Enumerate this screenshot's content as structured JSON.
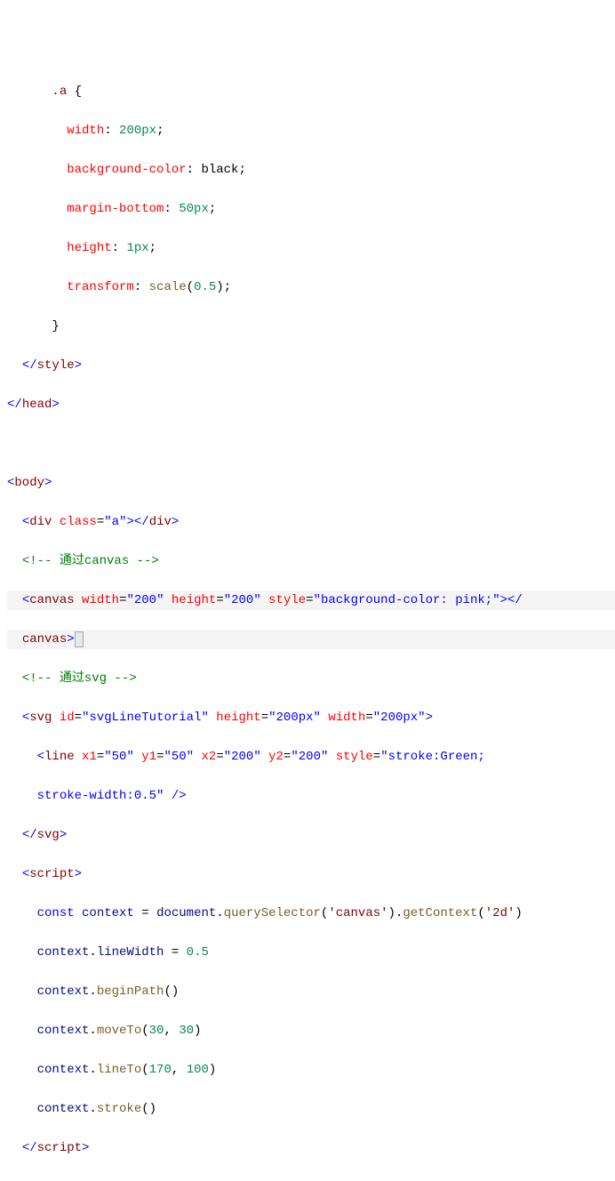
{
  "code": {
    "lines": [
      {
        "indent": 3,
        "segments": [
          {
            "t": ".a ",
            "c": "c-sel"
          },
          {
            "t": "{",
            "c": "c-punc"
          }
        ]
      },
      {
        "indent": 4,
        "segments": [
          {
            "t": "width",
            "c": "c-prop"
          },
          {
            "t": ": ",
            "c": "c-punc"
          },
          {
            "t": "200px",
            "c": "c-num"
          },
          {
            "t": ";",
            "c": "c-punc"
          }
        ]
      },
      {
        "indent": 4,
        "segments": [
          {
            "t": "background-color",
            "c": "c-prop"
          },
          {
            "t": ": ",
            "c": "c-punc"
          },
          {
            "t": "black",
            "c": "c-valk"
          },
          {
            "t": ";",
            "c": "c-punc"
          }
        ]
      },
      {
        "indent": 4,
        "segments": [
          {
            "t": "margin-bottom",
            "c": "c-prop"
          },
          {
            "t": ": ",
            "c": "c-punc"
          },
          {
            "t": "50px",
            "c": "c-num"
          },
          {
            "t": ";",
            "c": "c-punc"
          }
        ]
      },
      {
        "indent": 4,
        "segments": [
          {
            "t": "height",
            "c": "c-prop"
          },
          {
            "t": ": ",
            "c": "c-punc"
          },
          {
            "t": "1px",
            "c": "c-num"
          },
          {
            "t": ";",
            "c": "c-punc"
          }
        ]
      },
      {
        "indent": 4,
        "segments": [
          {
            "t": "transform",
            "c": "c-prop"
          },
          {
            "t": ": ",
            "c": "c-punc"
          },
          {
            "t": "scale",
            "c": "c-func"
          },
          {
            "t": "(",
            "c": "c-punc"
          },
          {
            "t": "0.5",
            "c": "c-num"
          },
          {
            "t": ");",
            "c": "c-punc"
          }
        ]
      },
      {
        "indent": 3,
        "segments": [
          {
            "t": "}",
            "c": "c-punc"
          }
        ]
      },
      {
        "indent": 1,
        "segments": [
          {
            "t": "</",
            "c": "c-delim"
          },
          {
            "t": "style",
            "c": "c-tag"
          },
          {
            "t": ">",
            "c": "c-delim"
          }
        ]
      },
      {
        "indent": 0,
        "segments": [
          {
            "t": "</",
            "c": "c-delim"
          },
          {
            "t": "head",
            "c": "c-tag"
          },
          {
            "t": ">",
            "c": "c-delim"
          }
        ]
      },
      {
        "indent": 0,
        "segments": [
          {
            "t": " ",
            "c": ""
          }
        ]
      },
      {
        "indent": 0,
        "segments": [
          {
            "t": "<",
            "c": "c-delim"
          },
          {
            "t": "body",
            "c": "c-tag"
          },
          {
            "t": ">",
            "c": "c-delim"
          }
        ]
      },
      {
        "indent": 1,
        "segments": [
          {
            "t": "<",
            "c": "c-delim"
          },
          {
            "t": "div",
            "c": "c-tag"
          },
          {
            "t": " ",
            "c": ""
          },
          {
            "t": "class",
            "c": "c-attr"
          },
          {
            "t": "=",
            "c": "c-punc"
          },
          {
            "t": "\"a\"",
            "c": "c-str"
          },
          {
            "t": "></",
            "c": "c-delim"
          },
          {
            "t": "div",
            "c": "c-tag"
          },
          {
            "t": ">",
            "c": "c-delim"
          }
        ]
      },
      {
        "indent": 1,
        "segments": [
          {
            "t": "<!-- 通过canvas -->",
            "c": "c-cmt"
          }
        ]
      },
      {
        "indent": 1,
        "hl": true,
        "segments": [
          {
            "t": "<",
            "c": "c-delim"
          },
          {
            "t": "canvas",
            "c": "c-tag"
          },
          {
            "t": " ",
            "c": ""
          },
          {
            "t": "width",
            "c": "c-attr"
          },
          {
            "t": "=",
            "c": "c-punc"
          },
          {
            "t": "\"200\"",
            "c": "c-str"
          },
          {
            "t": " ",
            "c": ""
          },
          {
            "t": "height",
            "c": "c-attr"
          },
          {
            "t": "=",
            "c": "c-punc"
          },
          {
            "t": "\"200\"",
            "c": "c-str"
          },
          {
            "t": " ",
            "c": ""
          },
          {
            "t": "style",
            "c": "c-attr"
          },
          {
            "t": "=",
            "c": "c-punc"
          },
          {
            "t": "\"background-color: pink;\"",
            "c": "c-str"
          },
          {
            "t": ">",
            "c": "c-delim"
          },
          {
            "t": "</",
            "c": "c-delim"
          }
        ]
      },
      {
        "indent": 1,
        "hl": true,
        "cursor": true,
        "segments": [
          {
            "t": "canvas",
            "c": "c-tag"
          },
          {
            "t": ">",
            "c": "c-delim"
          }
        ]
      },
      {
        "indent": 1,
        "segments": [
          {
            "t": "<!-- 通过svg -->",
            "c": "c-cmt"
          }
        ]
      },
      {
        "indent": 1,
        "segments": [
          {
            "t": "<",
            "c": "c-delim"
          },
          {
            "t": "svg",
            "c": "c-tag"
          },
          {
            "t": " ",
            "c": ""
          },
          {
            "t": "id",
            "c": "c-attr"
          },
          {
            "t": "=",
            "c": "c-punc"
          },
          {
            "t": "\"svgLineTutorial\"",
            "c": "c-str"
          },
          {
            "t": " ",
            "c": ""
          },
          {
            "t": "height",
            "c": "c-attr"
          },
          {
            "t": "=",
            "c": "c-punc"
          },
          {
            "t": "\"200px\"",
            "c": "c-str"
          },
          {
            "t": " ",
            "c": ""
          },
          {
            "t": "width",
            "c": "c-attr"
          },
          {
            "t": "=",
            "c": "c-punc"
          },
          {
            "t": "\"200px\"",
            "c": "c-str"
          },
          {
            "t": ">",
            "c": "c-delim"
          }
        ]
      },
      {
        "indent": 2,
        "segments": [
          {
            "t": "<",
            "c": "c-delim"
          },
          {
            "t": "line",
            "c": "c-tag"
          },
          {
            "t": " ",
            "c": ""
          },
          {
            "t": "x1",
            "c": "c-attr"
          },
          {
            "t": "=",
            "c": "c-punc"
          },
          {
            "t": "\"50\"",
            "c": "c-str"
          },
          {
            "t": " ",
            "c": ""
          },
          {
            "t": "y1",
            "c": "c-attr"
          },
          {
            "t": "=",
            "c": "c-punc"
          },
          {
            "t": "\"50\"",
            "c": "c-str"
          },
          {
            "t": " ",
            "c": ""
          },
          {
            "t": "x2",
            "c": "c-attr"
          },
          {
            "t": "=",
            "c": "c-punc"
          },
          {
            "t": "\"200\"",
            "c": "c-str"
          },
          {
            "t": " ",
            "c": ""
          },
          {
            "t": "y2",
            "c": "c-attr"
          },
          {
            "t": "=",
            "c": "c-punc"
          },
          {
            "t": "\"200\"",
            "c": "c-str"
          },
          {
            "t": " ",
            "c": ""
          },
          {
            "t": "style",
            "c": "c-attr"
          },
          {
            "t": "=",
            "c": "c-punc"
          },
          {
            "t": "\"stroke:Green;",
            "c": "c-str"
          }
        ]
      },
      {
        "indent": 2,
        "segments": [
          {
            "t": "stroke-width:0.5\"",
            "c": "c-str"
          },
          {
            "t": " />",
            "c": "c-delim"
          }
        ]
      },
      {
        "indent": 1,
        "segments": [
          {
            "t": "</",
            "c": "c-delim"
          },
          {
            "t": "svg",
            "c": "c-tag"
          },
          {
            "t": ">",
            "c": "c-delim"
          }
        ]
      },
      {
        "indent": 1,
        "segments": [
          {
            "t": "<",
            "c": "c-delim"
          },
          {
            "t": "script",
            "c": "c-tag"
          },
          {
            "t": ">",
            "c": "c-delim"
          }
        ]
      },
      {
        "indent": 2,
        "segments": [
          {
            "t": "const",
            "c": "c-kw"
          },
          {
            "t": " ",
            "c": ""
          },
          {
            "t": "context",
            "c": "c-var"
          },
          {
            "t": " = ",
            "c": "c-punc"
          },
          {
            "t": "document",
            "c": "c-var"
          },
          {
            "t": ".",
            "c": "c-punc"
          },
          {
            "t": "querySelector",
            "c": "c-func"
          },
          {
            "t": "(",
            "c": "c-punc"
          },
          {
            "t": "'canvas'",
            "c": "c-tag"
          },
          {
            "t": ").",
            "c": "c-punc"
          },
          {
            "t": "getContext",
            "c": "c-func"
          },
          {
            "t": "(",
            "c": "c-punc"
          },
          {
            "t": "'2d'",
            "c": "c-tag"
          },
          {
            "t": ")",
            "c": "c-punc"
          }
        ]
      },
      {
        "indent": 2,
        "segments": [
          {
            "t": "context",
            "c": "c-var"
          },
          {
            "t": ".",
            "c": "c-punc"
          },
          {
            "t": "lineWidth",
            "c": "c-var"
          },
          {
            "t": " = ",
            "c": "c-punc"
          },
          {
            "t": "0.5",
            "c": "c-num"
          }
        ]
      },
      {
        "indent": 2,
        "segments": [
          {
            "t": "context",
            "c": "c-var"
          },
          {
            "t": ".",
            "c": "c-punc"
          },
          {
            "t": "beginPath",
            "c": "c-func"
          },
          {
            "t": "()",
            "c": "c-punc"
          }
        ]
      },
      {
        "indent": 2,
        "segments": [
          {
            "t": "context",
            "c": "c-var"
          },
          {
            "t": ".",
            "c": "c-punc"
          },
          {
            "t": "moveTo",
            "c": "c-func"
          },
          {
            "t": "(",
            "c": "c-punc"
          },
          {
            "t": "30",
            "c": "c-num"
          },
          {
            "t": ", ",
            "c": "c-punc"
          },
          {
            "t": "30",
            "c": "c-num"
          },
          {
            "t": ")",
            "c": "c-punc"
          }
        ]
      },
      {
        "indent": 2,
        "segments": [
          {
            "t": "context",
            "c": "c-var"
          },
          {
            "t": ".",
            "c": "c-punc"
          },
          {
            "t": "lineTo",
            "c": "c-func"
          },
          {
            "t": "(",
            "c": "c-punc"
          },
          {
            "t": "170",
            "c": "c-num"
          },
          {
            "t": ", ",
            "c": "c-punc"
          },
          {
            "t": "100",
            "c": "c-num"
          },
          {
            "t": ")",
            "c": "c-punc"
          }
        ]
      },
      {
        "indent": 2,
        "segments": [
          {
            "t": "context",
            "c": "c-var"
          },
          {
            "t": ".",
            "c": "c-punc"
          },
          {
            "t": "stroke",
            "c": "c-func"
          },
          {
            "t": "()",
            "c": "c-punc"
          }
        ]
      },
      {
        "indent": 1,
        "segments": [
          {
            "t": "</",
            "c": "c-delim"
          },
          {
            "t": "script",
            "c": "c-tag"
          },
          {
            "t": ">",
            "c": "c-delim"
          }
        ]
      }
    ]
  }
}
